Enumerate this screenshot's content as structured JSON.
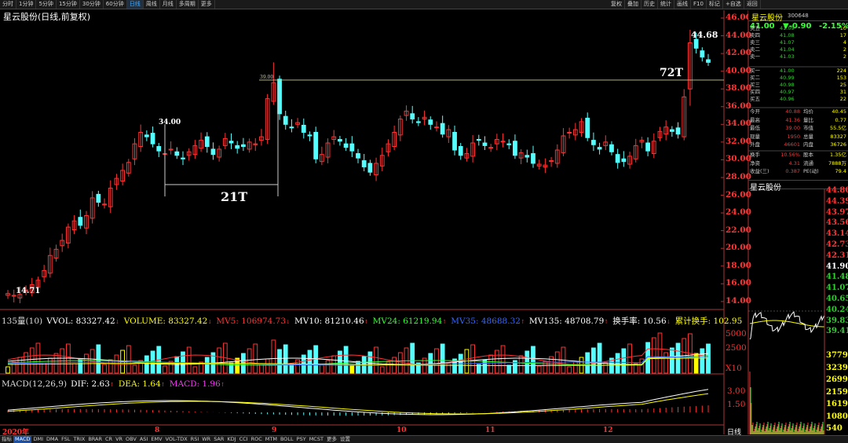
{
  "topbar": {
    "items_left": [
      "分时",
      "1分钟",
      "5分钟",
      "15分钟",
      "30分钟",
      "60分钟",
      "日线",
      "周线",
      "月线",
      "多周期",
      "更多"
    ],
    "selected": "日线",
    "items_right": [
      "复权",
      "叠加",
      "历史",
      "统计",
      "画线",
      "F10",
      "标记",
      "+自选",
      "返回"
    ]
  },
  "botbar": {
    "items": [
      "指标",
      "MACD",
      "DMI",
      "DMA",
      "FSL",
      "TRIX",
      "BRAR",
      "CR",
      "VR",
      "OBV",
      "ASI",
      "EMV",
      "VOL-TDX",
      "RSI",
      "WR",
      "SAR",
      "KDJ",
      "CCI",
      "ROC",
      "MTM",
      "BOLL",
      "PSY",
      "MCST",
      "更多",
      "设置"
    ],
    "selected": "MACD"
  },
  "chart_title": "星云股份(日线,前复权)",
  "price_axis": [
    "46.00",
    "44.00",
    "42.00",
    "40.00",
    "38.00",
    "36.00",
    "34.00",
    "32.00",
    "30.00",
    "28.00",
    "26.00",
    "24.00",
    "22.00",
    "20.00",
    "18.00",
    "16.00",
    "14.00"
  ],
  "annotations": {
    "high_label": "44.68",
    "low_label": "14.71",
    "level_34": "34.00",
    "level_39": "39.00",
    "span_21": "21T",
    "span_72": "72T"
  },
  "volume_indicator": {
    "name": "135量(10)",
    "vvol": "VVOL: 83327.42",
    "volume": "VOLUME: 83327.42",
    "mv5": "MV5: 106974.73",
    "mv10": "MV10: 81210.46",
    "mv24": "MV24: 61219.94",
    "mv35": "MV35: 48688.32",
    "mv135": "MV135: 48708.79",
    "turnover": "换手率: 10.56",
    "cum_turnover": "累计换手: 102.95",
    "axis": [
      "5000",
      "2500"
    ],
    "unit": "X10"
  },
  "macd_indicator": {
    "name": "MACD(12,26,9)",
    "dif": "DIF: 2.63",
    "dea": "DEA: 1.64",
    "macd": "MACD: 1.96",
    "axis": [
      "3.00",
      "1.50"
    ]
  },
  "x_labels": [
    "2020年",
    "8",
    "9",
    "10",
    "11",
    "12"
  ],
  "bottom_right_label": "日线",
  "quote": {
    "name": "星云股份",
    "code": "300648",
    "price": "41.00",
    "change": "▼-0.90",
    "pct": "-2.15%",
    "asks": [
      {
        "label": "卖五",
        "price": "41.09",
        "vol": "10"
      },
      {
        "label": "卖四",
        "price": "41.08",
        "vol": "17"
      },
      {
        "label": "卖三",
        "price": "41.07",
        "vol": "4"
      },
      {
        "label": "卖二",
        "price": "41.04",
        "vol": "2"
      },
      {
        "label": "卖一",
        "price": "41.03",
        "vol": "2"
      }
    ],
    "bids": [
      {
        "label": "买一",
        "price": "41.00",
        "vol": "224"
      },
      {
        "label": "买二",
        "price": "40.99",
        "vol": "153"
      },
      {
        "label": "买三",
        "price": "40.98",
        "vol": "25"
      },
      {
        "label": "买四",
        "price": "40.97",
        "vol": "31"
      },
      {
        "label": "买五",
        "price": "40.96",
        "vol": "22"
      }
    ],
    "details": [
      {
        "l1": "今开",
        "v1": "40.88",
        "l2": "均价",
        "v2": "40.45"
      },
      {
        "l1": "最高",
        "v1": "41.36",
        "l2": "量比",
        "v2": "0.77"
      },
      {
        "l1": "最低",
        "v1": "39.00",
        "l2": "市值",
        "v2": "55.5亿"
      },
      {
        "l1": "现量",
        "v1": "1950",
        "l2": "总量",
        "v2": "83327"
      },
      {
        "l1": "外盘",
        "v1": "46601",
        "l2": "内盘",
        "v2": "36726"
      }
    ],
    "details2": [
      {
        "l1": "换手",
        "v1": "10.56%",
        "l2": "股本",
        "v2": "1.35亿"
      },
      {
        "l1": "净资",
        "v1": "4.31",
        "l2": "流通",
        "v2": "7888万"
      },
      {
        "l1": "收益(三)",
        "v1": "0.387",
        "l2": "PE(动)",
        "v2": "79.4"
      }
    ]
  },
  "intraday": {
    "title": "星云股份",
    "price_axis": [
      "44.80",
      "44.39",
      "43.97",
      "43.56",
      "43.14",
      "42.73",
      "42.31",
      "41.90",
      "41.48",
      "41.07",
      "40.65",
      "40.24",
      "39.83",
      "39.41"
    ],
    "vol_axis": [
      "3779",
      "3239",
      "2699",
      "2159",
      "1619",
      "1080",
      "540"
    ]
  },
  "chart_data": {
    "type": "candlestick",
    "title": "星云股份(日线,前复权)",
    "ylim": [
      14,
      46
    ],
    "dates_labeled": [
      "2020年",
      "8",
      "9",
      "10",
      "11",
      "12"
    ],
    "closes": [
      14.9,
      14.7,
      14.8,
      15.3,
      15.9,
      16.4,
      17.5,
      19.2,
      19.9,
      20.9,
      22.4,
      23.1,
      22.6,
      23.7,
      25.7,
      25.2,
      25.0,
      26.8,
      27.9,
      28.8,
      29.7,
      31.8,
      33.1,
      32.6,
      31.8,
      31.0,
      30.7,
      31.2,
      30.5,
      30.1,
      30.9,
      31.6,
      32.2,
      31.5,
      30.6,
      31.2,
      32.4,
      31.9,
      31.3,
      31.5,
      32.0,
      31.8,
      32.6,
      36.9,
      38.7,
      35.2,
      34.0,
      33.6,
      34.2,
      33.1,
      32.7,
      30.1,
      30.6,
      31.9,
      32.6,
      32.1,
      31.4,
      31.0,
      30.2,
      29.2,
      28.6,
      29.6,
      30.5,
      31.8,
      33.1,
      34.6,
      35.5,
      34.6,
      34.2,
      34.8,
      34.0,
      33.7,
      32.9,
      33.4,
      31.1,
      30.5,
      30.7,
      31.9,
      32.2,
      31.6,
      31.4,
      32.3,
      32.1,
      31.7,
      30.5,
      30.8,
      30.3,
      29.6,
      29.5,
      29.4,
      29.9,
      31.1,
      32.7,
      33.1,
      33.4,
      34.3,
      32.5,
      31.7,
      31.2,
      32.0,
      30.9,
      29.7,
      29.8,
      30.4,
      31.6,
      32.2,
      31.0,
      32.1,
      33.2,
      33.7,
      33.2,
      32.9,
      37.1,
      43.2,
      42.6,
      41.6,
      41.0
    ],
    "high": 44.68,
    "low": 14.71,
    "levels": [
      34.0,
      39.0
    ],
    "volume_x10_series": [
      "VOLUME",
      "MV5",
      "MV10",
      "MV24",
      "MV35",
      "MV135"
    ],
    "macd_series": [
      "DIF",
      "DEA",
      "MACD"
    ]
  }
}
